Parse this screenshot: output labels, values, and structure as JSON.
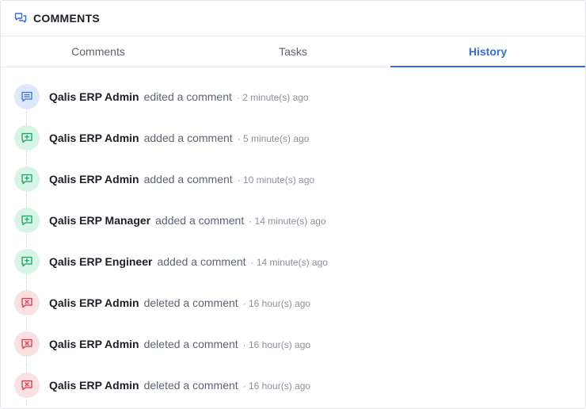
{
  "header": {
    "title": "COMMENTS",
    "icon": "comments-icon"
  },
  "tabs": [
    {
      "label": "Comments",
      "active": false
    },
    {
      "label": "Tasks",
      "active": false
    },
    {
      "label": "History",
      "active": true
    }
  ],
  "colors": {
    "accent": "#2f6fe0",
    "edit": "#3b6fd4",
    "add": "#1e9e62",
    "delete": "#d43b4b"
  },
  "history": [
    {
      "type": "edit",
      "icon": "edit-comment-icon",
      "user": "Qalis ERP Admin",
      "action": "edited a comment",
      "time": "· 2 minute(s) ago"
    },
    {
      "type": "add",
      "icon": "add-comment-icon",
      "user": "Qalis ERP Admin",
      "action": "added a comment",
      "time": "· 5 minute(s) ago"
    },
    {
      "type": "add",
      "icon": "add-comment-icon",
      "user": "Qalis ERP Admin",
      "action": "added a comment",
      "time": "· 10 minute(s) ago"
    },
    {
      "type": "add",
      "icon": "add-comment-icon",
      "user": "Qalis ERP Manager",
      "action": "added a comment",
      "time": "· 14 minute(s) ago"
    },
    {
      "type": "add",
      "icon": "add-comment-icon",
      "user": "Qalis ERP Engineer",
      "action": "added a comment",
      "time": "· 14 minute(s) ago"
    },
    {
      "type": "del",
      "icon": "delete-comment-icon",
      "user": "Qalis ERP Admin",
      "action": "deleted a comment",
      "time": "· 16 hour(s) ago"
    },
    {
      "type": "del",
      "icon": "delete-comment-icon",
      "user": "Qalis ERP Admin",
      "action": "deleted a comment",
      "time": "· 16 hour(s) ago"
    },
    {
      "type": "del",
      "icon": "delete-comment-icon",
      "user": "Qalis ERP Admin",
      "action": "deleted a comment",
      "time": "· 16 hour(s) ago"
    }
  ]
}
